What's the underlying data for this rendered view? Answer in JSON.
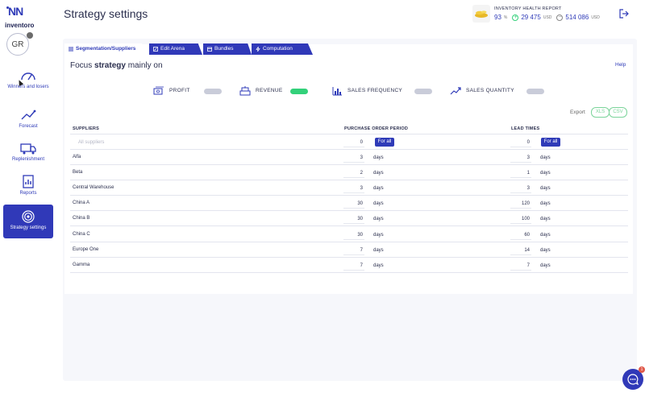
{
  "brand": {
    "name": "inventoro",
    "mark": "NN"
  },
  "user": {
    "initials": "GR"
  },
  "sidebar": {
    "items": [
      {
        "label": "Winners and losers",
        "icon": "gauge-icon"
      },
      {
        "label": "Forecast",
        "icon": "trend-icon"
      },
      {
        "label": "Replenishment",
        "icon": "truck-icon"
      },
      {
        "label": "Reports",
        "icon": "report-icon"
      },
      {
        "label": "Strategy settings",
        "icon": "target-icon",
        "active": true
      }
    ]
  },
  "header": {
    "title": "Strategy settings",
    "report_title": "INVENTORY HEALTH REPORT",
    "health_pct": "93",
    "health_unit": "%",
    "plus_value": "29 475",
    "plus_unit": "USD",
    "minus_value": "514 086",
    "minus_unit": "USD"
  },
  "tabs": [
    {
      "label": "Segmentation/Suppliers",
      "icon": "list-icon",
      "active": true
    },
    {
      "label": "Edit Arena",
      "icon": "edit-icon"
    },
    {
      "label": "Bundles",
      "icon": "box-icon"
    },
    {
      "label": "Computation",
      "icon": "bolt-icon"
    }
  ],
  "focus": {
    "prefix": "Focus",
    "strong": "strategy",
    "suffix": "mainly on"
  },
  "help_label": "Help",
  "strategy_toggles": [
    {
      "label": "PROFIT",
      "on": false,
      "icon": "profit-icon"
    },
    {
      "label": "REVENUE",
      "on": true,
      "icon": "revenue-icon"
    },
    {
      "label": "SALES FREQUENCY",
      "on": false,
      "icon": "frequency-icon"
    },
    {
      "label": "SALES QUANTITY",
      "on": false,
      "icon": "quantity-icon"
    }
  ],
  "export": {
    "label": "Export",
    "xls": "XLS",
    "csv": "CSV"
  },
  "table": {
    "headers": {
      "suppliers": "SUPPLIERS",
      "purchase": "PURCHASE ORDER PERIOD",
      "lead": "LEAD TIMES"
    },
    "all_row": {
      "placeholder": "All suppliers",
      "purchase": "0",
      "lead": "0",
      "button": "For all"
    },
    "unit": "days",
    "rows": [
      {
        "name": "Alfa",
        "purchase": "3",
        "lead": "3"
      },
      {
        "name": "Beta",
        "purchase": "2",
        "lead": "1"
      },
      {
        "name": "Central Warehouse",
        "purchase": "3",
        "lead": "3"
      },
      {
        "name": "China A",
        "purchase": "30",
        "lead": "120"
      },
      {
        "name": "China B",
        "purchase": "30",
        "lead": "100"
      },
      {
        "name": "China C",
        "purchase": "30",
        "lead": "60"
      },
      {
        "name": "Europe One",
        "purchase": "7",
        "lead": "14"
      },
      {
        "name": "Gamma",
        "purchase": "7",
        "lead": "7"
      }
    ]
  },
  "chat": {
    "badge": "1"
  },
  "colors": {
    "brand": "#3039b8",
    "toggle_on": "#33d17a",
    "export": "#7bd49a"
  }
}
